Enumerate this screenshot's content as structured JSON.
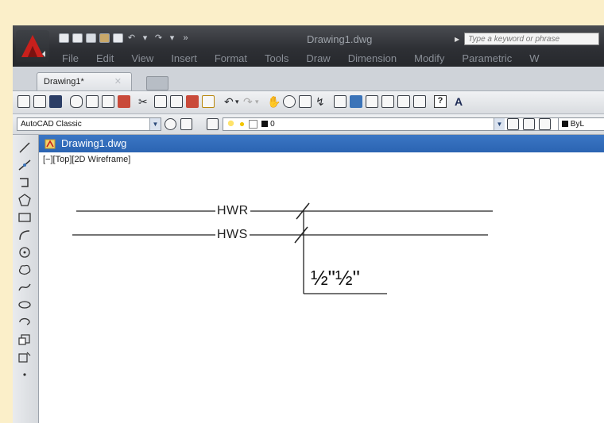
{
  "app": {
    "document_title": "Drawing1.dwg",
    "search_placeholder": "Type a keyword or phrase"
  },
  "menubar": {
    "items": [
      "File",
      "Edit",
      "View",
      "Insert",
      "Format",
      "Tools",
      "Draw",
      "Dimension",
      "Modify",
      "Parametric",
      "W"
    ]
  },
  "tabs": {
    "active_tab": "Drawing1*"
  },
  "toolbar": {
    "help_label": "?",
    "text_style_label": "A"
  },
  "workspace": {
    "selected": "AutoCAD Classic"
  },
  "layer": {
    "current": "0",
    "color_label": "ByL"
  },
  "drawing": {
    "window_title": "Drawing1.dwg",
    "viewport_label": "[−][Top][2D Wireframe]",
    "pipes": [
      {
        "label": "HWR"
      },
      {
        "label": "HWS"
      }
    ],
    "size_annotation": "½\"½\""
  },
  "colors": {
    "background": "#fbefc9",
    "titlebar": "#2e3035",
    "drawing_titlebar": "#3b76c4",
    "app_logo": "#c8201c"
  }
}
